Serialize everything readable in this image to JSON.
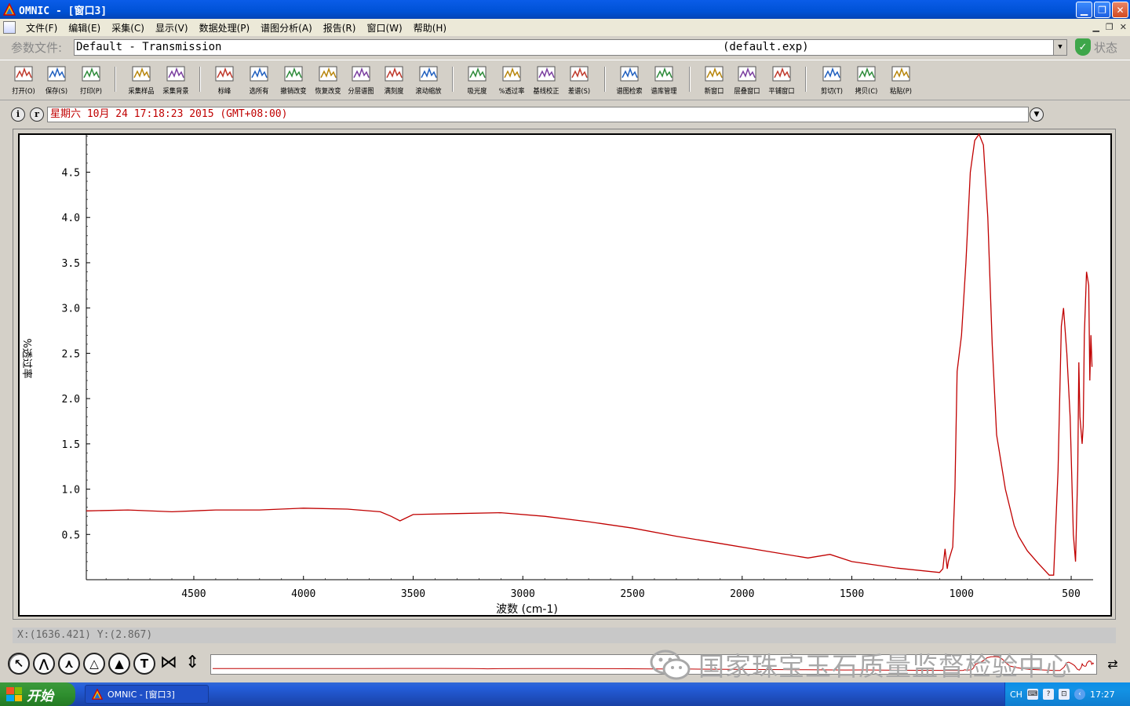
{
  "window": {
    "title": "OMNIC - [窗口3]"
  },
  "menu": {
    "items": [
      "文件(F)",
      "编辑(E)",
      "采集(C)",
      "显示(V)",
      "数据处理(P)",
      "谱图分析(A)",
      "报告(R)",
      "窗口(W)",
      "帮助(H)"
    ]
  },
  "params": {
    "label": "参数文件:",
    "value": "Default - Transmission",
    "exp": "(default.exp)",
    "status_label": "状态"
  },
  "toolbar": {
    "items": [
      {
        "label": "打开(O)",
        "icon": "open-icon"
      },
      {
        "label": "保存(S)",
        "icon": "save-icon"
      },
      {
        "label": "打印(P)",
        "icon": "print-icon"
      },
      {
        "label": "采集样品",
        "icon": "collect-sample-icon"
      },
      {
        "label": "采集背景",
        "icon": "collect-background-icon"
      },
      {
        "label": "标峰",
        "icon": "find-peaks-icon"
      },
      {
        "label": "选所有",
        "icon": "select-all-icon"
      },
      {
        "label": "撤销改变",
        "icon": "undo-icon"
      },
      {
        "label": "恢复改变",
        "icon": "redo-icon"
      },
      {
        "label": "分层谱图",
        "icon": "stack-spectra-icon"
      },
      {
        "label": "满刻度",
        "icon": "full-scale-icon"
      },
      {
        "label": "滚动缩放",
        "icon": "roll-zoom-icon"
      },
      {
        "label": "吸光度",
        "icon": "absorbance-icon"
      },
      {
        "label": "%透过率",
        "icon": "transmittance-icon"
      },
      {
        "label": "基线校正",
        "icon": "baseline-correct-icon"
      },
      {
        "label": "差谱(S)",
        "icon": "subtract-icon"
      },
      {
        "label": "谱图检索",
        "icon": "search-spectra-icon"
      },
      {
        "label": "谱库管理",
        "icon": "library-manager-icon"
      },
      {
        "label": "新窗口",
        "icon": "new-window-icon"
      },
      {
        "label": "层叠窗口",
        "icon": "cascade-windows-icon"
      },
      {
        "label": "平铺窗口",
        "icon": "tile-windows-icon"
      },
      {
        "label": "剪切(T)",
        "icon": "cut-icon"
      },
      {
        "label": "拷贝(C)",
        "icon": "copy-icon"
      },
      {
        "label": "粘贴(P)",
        "icon": "paste-icon"
      }
    ]
  },
  "info": {
    "text": "星期六 10月 24 17:18:23 2015 (GMT+08:00)"
  },
  "coords": {
    "text": "X:(1636.421) Y:(2.867)"
  },
  "watermark": {
    "text": "国家珠宝玉石质量监督检验中心"
  },
  "taskbar": {
    "start": "开始",
    "task": "OMNIC - [窗口3]",
    "lang": "CH",
    "clock": "17:27"
  },
  "colors": {
    "spectrum": "#c00000",
    "titlebar": "#0a5ce8",
    "taskbar": "#245edb"
  },
  "chart_data": {
    "type": "line",
    "xlabel": "波数 (cm-1)",
    "ylabel": "%透过率",
    "xlim": [
      4990,
      400
    ],
    "ylim": [
      0,
      4.92
    ],
    "xticks": [
      4500,
      4000,
      3500,
      3000,
      2500,
      2000,
      1500,
      1000,
      500
    ],
    "yticks": [
      0.5,
      1.0,
      1.5,
      2.0,
      2.5,
      3.0,
      3.5,
      4.0,
      4.5
    ],
    "series": [
      {
        "x": [
          4990,
          4800,
          4600,
          4400,
          4200,
          4000,
          3800,
          3650,
          3600,
          3560,
          3500,
          3300,
          3100,
          2900,
          2700,
          2500,
          2300,
          2100,
          1900,
          1700,
          1600,
          1500,
          1300,
          1100,
          1085,
          1075,
          1065,
          1060,
          1040,
          1030,
          1020,
          1000,
          980,
          960,
          940,
          920,
          900,
          880,
          860,
          840,
          820,
          800,
          780,
          760,
          740,
          700,
          650,
          600,
          580,
          560,
          545,
          535,
          520,
          505,
          490,
          480,
          470,
          465,
          460,
          450,
          445,
          440,
          430,
          420,
          415,
          410,
          405
        ],
        "y": [
          0.76,
          0.77,
          0.75,
          0.77,
          0.77,
          0.79,
          0.78,
          0.75,
          0.7,
          0.65,
          0.72,
          0.73,
          0.74,
          0.7,
          0.64,
          0.57,
          0.48,
          0.4,
          0.32,
          0.24,
          0.28,
          0.2,
          0.13,
          0.08,
          0.12,
          0.34,
          0.12,
          0.2,
          0.36,
          1.0,
          2.3,
          2.7,
          3.5,
          4.5,
          4.85,
          4.92,
          4.8,
          4.0,
          2.6,
          1.6,
          1.3,
          1.0,
          0.8,
          0.6,
          0.48,
          0.32,
          0.18,
          0.05,
          0.05,
          1.2,
          2.8,
          3.0,
          2.5,
          1.8,
          0.5,
          0.2,
          1.2,
          2.4,
          1.8,
          1.5,
          1.7,
          2.7,
          3.4,
          3.25,
          2.2,
          2.7,
          2.35
        ]
      }
    ]
  }
}
